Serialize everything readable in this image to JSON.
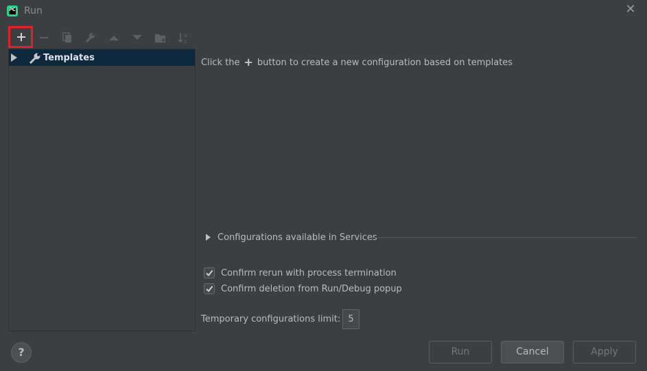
{
  "window": {
    "title": "Run",
    "close_glyph": "✕",
    "app_icon_text": "PC"
  },
  "toolbar": {
    "items": [
      {
        "name": "add-icon",
        "enabled": true,
        "highlighted": true
      },
      {
        "name": "remove-icon",
        "enabled": false
      },
      {
        "name": "copy-icon",
        "enabled": false
      },
      {
        "name": "wrench-icon",
        "enabled": false
      },
      {
        "name": "move-up-icon",
        "enabled": false
      },
      {
        "name": "move-down-icon",
        "enabled": false
      },
      {
        "name": "new-folder-icon",
        "enabled": false
      },
      {
        "name": "sort-icon",
        "enabled": false
      }
    ]
  },
  "tree": {
    "items": [
      {
        "label": "Templates",
        "icon": "wrench-icon",
        "selected": true
      }
    ]
  },
  "main": {
    "hint_before": "Click the",
    "hint_after": "button to create a new configuration based on templates",
    "services_label": "Configurations available in Services",
    "confirm_rerun": {
      "label": "Confirm rerun with process termination",
      "checked": true
    },
    "confirm_delete": {
      "label": "Confirm deletion from Run/Debug popup",
      "checked": true
    },
    "temp_limit_label": "Temporary configurations limit:",
    "temp_limit_value": "5"
  },
  "footer": {
    "help_label": "?",
    "run_label": "Run",
    "cancel_label": "Cancel",
    "apply_label": "Apply"
  },
  "colors": {
    "background": "#3c3f41",
    "selection": "#0d293e",
    "highlight_border": "#e5202b"
  }
}
